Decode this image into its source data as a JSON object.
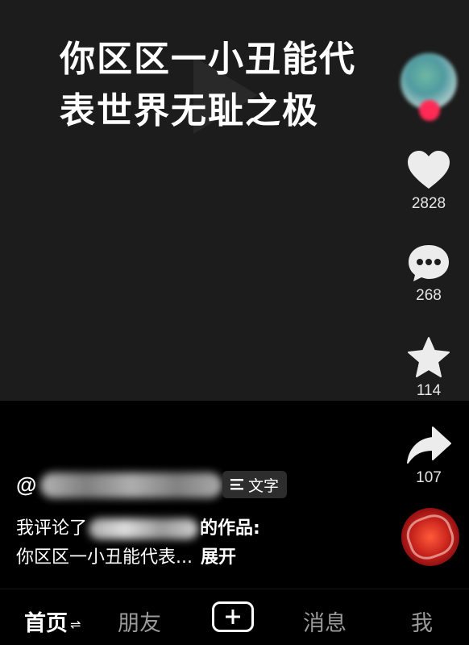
{
  "video": {
    "overlay_line_1": "你区区一小丑能代",
    "overlay_line_2": "表世界无耻之极"
  },
  "rail": {
    "like_count": "2828",
    "comment_count": "268",
    "favorite_count": "114",
    "share_count": "107",
    "icons": [
      "avatar",
      "heart-icon",
      "comment-icon",
      "star-icon",
      "share-icon",
      "music-disc"
    ]
  },
  "caption": {
    "author": "@",
    "text_button": "文字",
    "line1_prefix": "我评论了",
    "line1_suffix": "的作品:",
    "line2": "你区区一小丑能代表...",
    "expand": "展开"
  },
  "tabbar": {
    "home": "首页",
    "home_refresh": "⇌",
    "friends": "朋友",
    "messages": "消息",
    "me": "我"
  },
  "colors": {
    "background": "#000000",
    "video_bg": "#1c1c1c",
    "follow_accent": "#ff2a55",
    "inactive_tab": "#9a9a9a"
  }
}
